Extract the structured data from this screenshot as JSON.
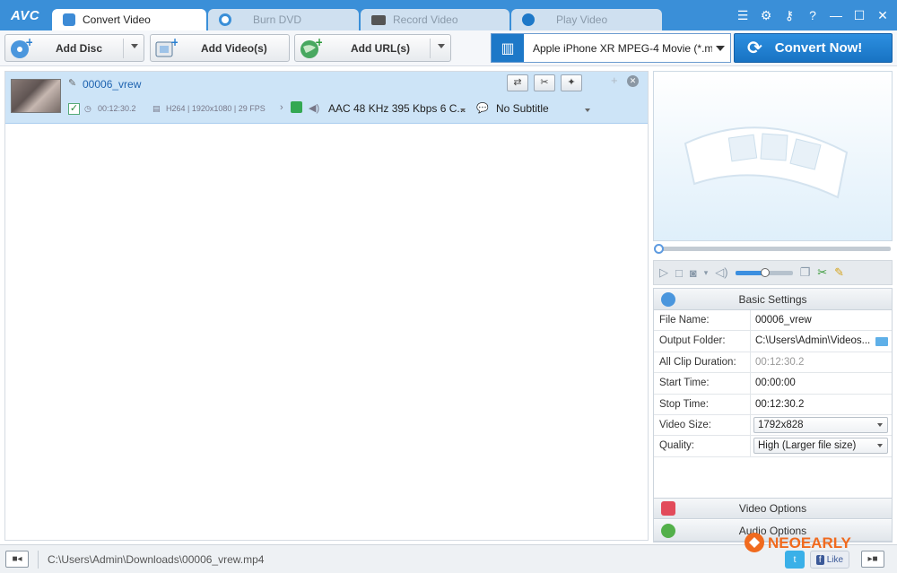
{
  "app": {
    "logo": "AVC"
  },
  "tabs": [
    {
      "label": "Convert Video"
    },
    {
      "label": "Burn DVD"
    },
    {
      "label": "Record Video"
    },
    {
      "label": "Play Video"
    }
  ],
  "window_icons": [
    "list-icon",
    "gear-icon",
    "key-icon",
    "help-icon",
    "minimize-icon",
    "maximize-icon",
    "close-icon"
  ],
  "toolbar": {
    "add_disc": "Add Disc",
    "add_videos": "Add Video(s)",
    "add_url": "Add URL(s)",
    "profile": "Apple iPhone XR MPEG-4 Movie (*.m...",
    "convert_now": "Convert Now!"
  },
  "file": {
    "name": "00006_vrew",
    "duration": "00:12:30.2",
    "video_info": "H264 | 1920x1080 | 29 FPS",
    "audio": "AAC 48 KHz 395 Kbps 6 C...",
    "subtitle": "No Subtitle"
  },
  "settings": {
    "title": "Basic Settings",
    "rows": [
      {
        "key": "File Name:",
        "value": "00006_vrew"
      },
      {
        "key": "Output Folder:",
        "value": "C:\\Users\\Admin\\Videos..."
      },
      {
        "key": "All Clip Duration:",
        "value": "00:12:30.2"
      },
      {
        "key": "Start Time:",
        "value": "00:00:00"
      },
      {
        "key": "Stop Time:",
        "value": "00:12:30.2"
      },
      {
        "key": "Video Size:",
        "value": "1792x828"
      },
      {
        "key": "Quality:",
        "value": "High (Larger file size)"
      }
    ],
    "video_options": "Video Options",
    "audio_options": "Audio Options"
  },
  "status": {
    "path": "C:\\Users\\Admin\\Downloads\\00006_vrew.mp4",
    "like": "Like"
  },
  "watermark": "NEOEARLY",
  "colors": {
    "accent": "#3a8fd8",
    "convert_button": "#1d7dd0",
    "selected_row": "#cde4f7"
  }
}
